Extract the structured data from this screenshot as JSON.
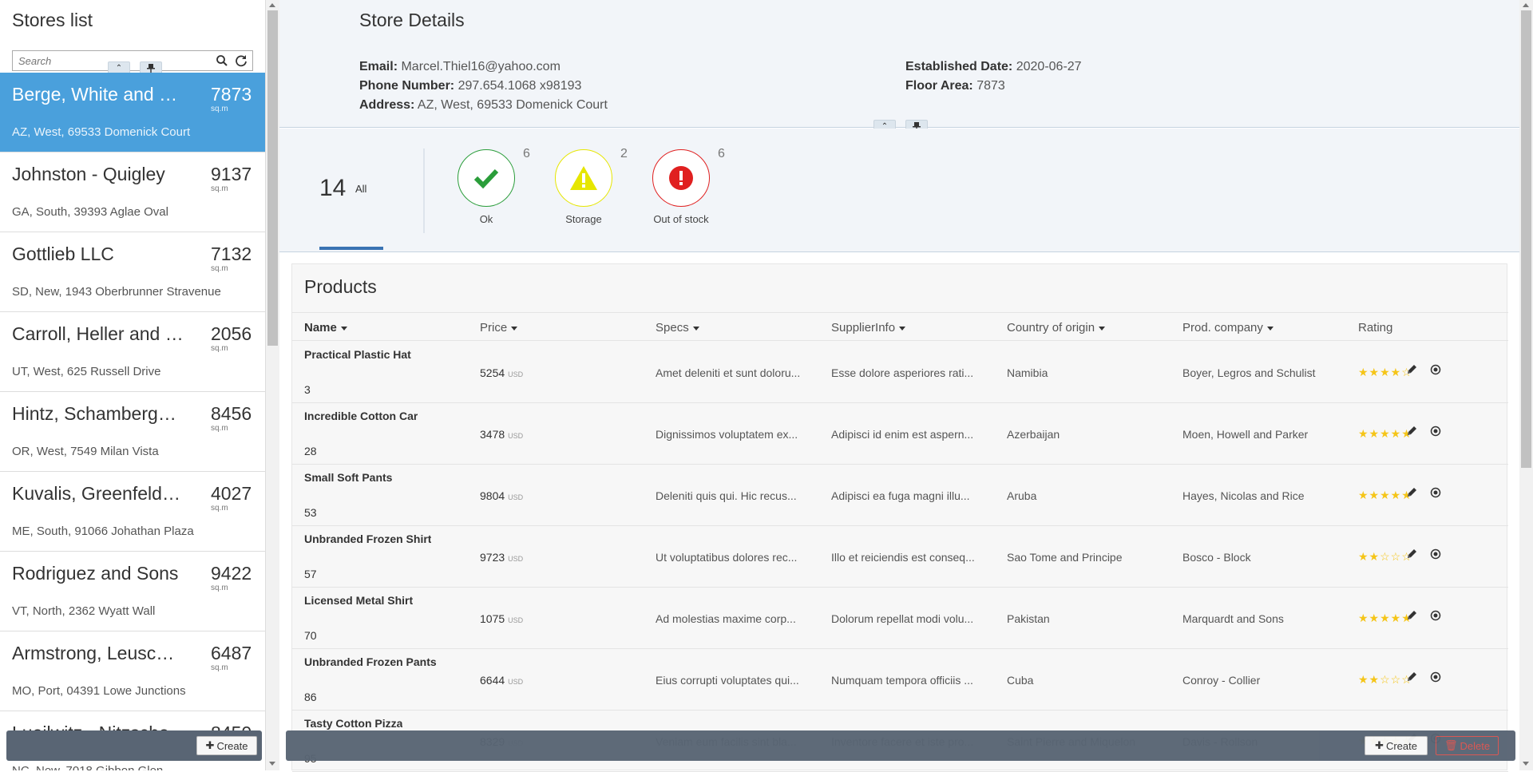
{
  "sidebar": {
    "title": "Stores list",
    "search_placeholder": "Search",
    "stores": [
      {
        "name": "Berge, White and Sons",
        "area": "7873",
        "unit": "sq.m",
        "address": "AZ, West, 69533 Domenick Court",
        "active": true
      },
      {
        "name": "Johnston - Quigley",
        "area": "9137",
        "unit": "sq.m",
        "address": "GA, South, 39393 Aglae Oval"
      },
      {
        "name": "Gottlieb LLC",
        "area": "7132",
        "unit": "sq.m",
        "address": "SD, New, 1943 Oberbrunner Stravenue"
      },
      {
        "name": "Carroll, Heller and Sons",
        "area": "2056",
        "unit": "sq.m",
        "address": "UT, West, 625 Russell Drive"
      },
      {
        "name": "Hintz, Schamberger and Sons",
        "area": "8456",
        "unit": "sq.m",
        "address": "OR, West, 7549 Milan Vista"
      },
      {
        "name": "Kuvalis, Greenfelder and Sons",
        "area": "4027",
        "unit": "sq.m",
        "address": "ME, South, 91066 Johathan Plaza"
      },
      {
        "name": "Rodriguez and Sons",
        "area": "9422",
        "unit": "sq.m",
        "address": "VT, North, 2362 Wyatt Wall"
      },
      {
        "name": "Armstrong, Leuschke and Sons",
        "area": "6487",
        "unit": "sq.m",
        "address": "MO, Port, 04391 Lowe Junctions"
      },
      {
        "name": "Lueilwitz - Nitzsche",
        "area": "8450",
        "unit": "sq.m",
        "address": "NC, New, 7018 Gibbon Glen"
      }
    ],
    "create_label": "Create"
  },
  "details": {
    "title": "Store Details",
    "email_label": "Email:",
    "email": "Marcel.Thiel16@yahoo.com",
    "phone_label": "Phone Number:",
    "phone": "297.654.1068 x98193",
    "address_label": "Address:",
    "address": "AZ, West, 69533 Domenick Court",
    "established_label": "Established Date:",
    "established": "2020-06-27",
    "floor_label": "Floor Area:",
    "floor": "7873"
  },
  "status": {
    "all_count": "14",
    "all_label": "All",
    "ok_count": "6",
    "ok_label": "Ok",
    "storage_count": "2",
    "storage_label": "Storage",
    "out_count": "6",
    "out_label": "Out of stock",
    "colors": {
      "ok": "#2a9d3a",
      "storage": "#e6e600",
      "out": "#e02020"
    }
  },
  "products": {
    "title": "Products",
    "columns": {
      "name": "Name",
      "price": "Price",
      "specs": "Specs",
      "supplier": "SupplierInfo",
      "country": "Country of origin",
      "company": "Prod. company",
      "rating": "Rating"
    },
    "currency": "USD",
    "rows": [
      {
        "name": "Practical Plastic Hat",
        "qty": "3",
        "price": "5254",
        "specs": "Amet deleniti et sunt doloru...",
        "supplier": "Esse dolore asperiores rati...",
        "country": "Namibia",
        "company": "Boyer, Legros and Schulist",
        "rating": "★★★★☆"
      },
      {
        "name": "Incredible Cotton Car",
        "qty": "28",
        "price": "3478",
        "specs": "Dignissimos voluptatem ex...",
        "supplier": "Adipisci id enim est aspern...",
        "country": "Azerbaijan",
        "company": "Moen, Howell and Parker",
        "rating": "★★★★★"
      },
      {
        "name": "Small Soft Pants",
        "qty": "53",
        "price": "9804",
        "specs": "Deleniti quis qui. Hic recus...",
        "supplier": "Adipisci ea fuga magni illu...",
        "country": "Aruba",
        "company": "Hayes, Nicolas and Rice",
        "rating": "★★★★★"
      },
      {
        "name": "Unbranded Frozen Shirt",
        "qty": "57",
        "price": "9723",
        "specs": "Ut voluptatibus dolores rec...",
        "supplier": "Illo et reiciendis est conseq...",
        "country": "Sao Tome and Principe",
        "company": "Bosco - Block",
        "rating": "★★☆☆☆"
      },
      {
        "name": "Licensed Metal Shirt",
        "qty": "70",
        "price": "1075",
        "specs": "Ad molestias maxime corp...",
        "supplier": "Dolorum repellat modi volu...",
        "country": "Pakistan",
        "company": "Marquardt and Sons",
        "rating": "★★★★★"
      },
      {
        "name": "Unbranded Frozen Pants",
        "qty": "86",
        "price": "6644",
        "specs": "Eius corrupti voluptates qui...",
        "supplier": "Numquam tempora officiis ...",
        "country": "Cuba",
        "company": "Conroy - Collier",
        "rating": "★★☆☆☆"
      },
      {
        "name": "Tasty Cotton Pizza",
        "qty": "95",
        "price": "8329",
        "specs": "Veniam eum facilis sint bla...",
        "supplier": "Inventore facere et iste pro...",
        "country": "Saint Pierre and Miquelon",
        "company": "Davis - Rollson",
        "rating": "★★★★★"
      }
    ]
  },
  "toolbar": {
    "create_label": "Create",
    "delete_label": "Delete"
  }
}
